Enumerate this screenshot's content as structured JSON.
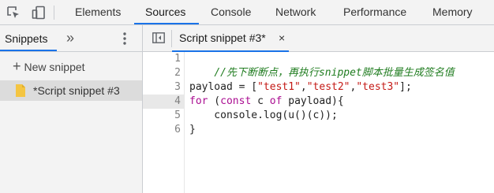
{
  "devtools": {
    "tabs": [
      {
        "label": "Elements"
      },
      {
        "label": "Sources"
      },
      {
        "label": "Console"
      },
      {
        "label": "Network"
      },
      {
        "label": "Performance"
      },
      {
        "label": "Memory"
      }
    ],
    "active_tab": "Sources"
  },
  "sidebar": {
    "tab_label": "Snippets",
    "more_tabs": "»",
    "new_snippet_label": "New snippet",
    "snippets": [
      {
        "label": "*Script snippet #3"
      }
    ]
  },
  "editor": {
    "open_file": "Script snippet #3*",
    "close_glyph": "×",
    "current_line": 4,
    "line_numbers": [
      "1",
      "2",
      "3",
      "4",
      "5",
      "6"
    ],
    "lines": [
      {
        "segments": [
          {
            "t": "//先下断断点，再执行snippet脚本批量生成签名值",
            "k": "comment"
          }
        ]
      },
      {
        "segments": [
          {
            "t": "",
            "k": "plain"
          }
        ]
      },
      {
        "segments": [
          {
            "t": "payload = [",
            "k": "plain"
          },
          {
            "t": "\"test1\"",
            "k": "str"
          },
          {
            "t": ",",
            "k": "plain"
          },
          {
            "t": "\"test2\"",
            "k": "str"
          },
          {
            "t": ",",
            "k": "plain"
          },
          {
            "t": "\"test3\"",
            "k": "str"
          },
          {
            "t": "];",
            "k": "plain"
          }
        ]
      },
      {
        "segments": [
          {
            "t": "for",
            "k": "kw"
          },
          {
            "t": " (",
            "k": "plain"
          },
          {
            "t": "const",
            "k": "kw"
          },
          {
            "t": " c ",
            "k": "plain"
          },
          {
            "t": "of",
            "k": "kw"
          },
          {
            "t": " payload){",
            "k": "plain"
          }
        ]
      },
      {
        "segments": [
          {
            "t": "    console.log(u()(c));",
            "k": "plain"
          }
        ]
      },
      {
        "segments": [
          {
            "t": "}",
            "k": "plain"
          }
        ]
      }
    ]
  },
  "colors": {
    "accent": "#1a73e8",
    "comment": "#1f7c1f",
    "keyword": "#aa0d91",
    "string": "#c41a16",
    "snippet_file_icon": "#f4c542"
  }
}
